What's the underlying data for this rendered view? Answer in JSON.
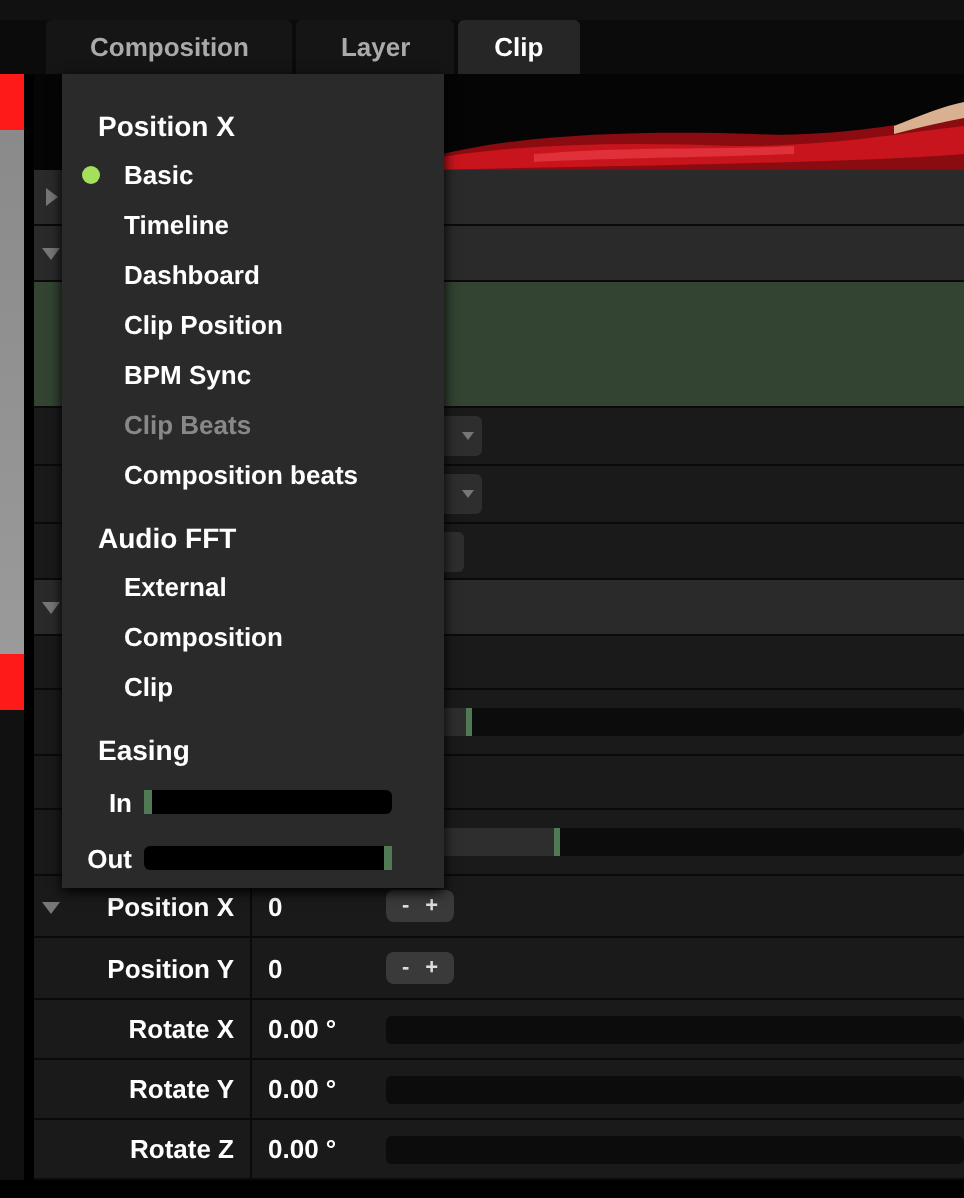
{
  "tabs": [
    {
      "label": "Composition",
      "selected": false
    },
    {
      "label": "Layer",
      "selected": false
    },
    {
      "label": "Clip",
      "selected": true
    }
  ],
  "rows": [
    {
      "kind": "header",
      "expanded": false
    },
    {
      "kind": "header",
      "expanded": true
    },
    {
      "kind": "highlight"
    },
    {
      "kind": "dropdown"
    },
    {
      "kind": "dropdown"
    },
    {
      "kind": "button"
    },
    {
      "kind": "header",
      "expanded": true
    },
    {
      "kind": "blank"
    },
    {
      "kind": "slider",
      "level": 0.14
    },
    {
      "kind": "blank"
    },
    {
      "kind": "slider",
      "level": 0.29
    },
    {
      "kind": "stepper",
      "label": "Position X",
      "value": "0",
      "expanded": true,
      "buttons": [
        "-",
        "+"
      ]
    },
    {
      "kind": "stepper",
      "label": "Position Y",
      "value": "0",
      "buttons": [
        "-",
        "+"
      ]
    },
    {
      "kind": "slider",
      "label": "Rotate X",
      "value": "0.00 °"
    },
    {
      "kind": "slider",
      "label": "Rotate Y",
      "value": "0.00 °"
    },
    {
      "kind": "slider",
      "label": "Rotate Z",
      "value": "0.00 °"
    }
  ],
  "menu": {
    "sections": [
      {
        "kind": "options",
        "title": "Position X",
        "items": [
          {
            "label": "Basic",
            "selected": true,
            "disabled": false
          },
          {
            "label": "Timeline",
            "selected": false,
            "disabled": false
          },
          {
            "label": "Dashboard",
            "selected": false,
            "disabled": false
          },
          {
            "label": "Clip Position",
            "selected": false,
            "disabled": false
          },
          {
            "label": "BPM Sync",
            "selected": false,
            "disabled": false
          },
          {
            "label": "Clip Beats",
            "selected": false,
            "disabled": true
          },
          {
            "label": "Composition beats",
            "selected": false,
            "disabled": false
          }
        ]
      },
      {
        "kind": "options",
        "title": "Audio FFT",
        "items": [
          {
            "label": "External",
            "selected": false,
            "disabled": false
          },
          {
            "label": "Composition",
            "selected": false,
            "disabled": false
          },
          {
            "label": "Clip",
            "selected": false,
            "disabled": false
          }
        ]
      },
      {
        "kind": "sliders",
        "title": "Easing",
        "sliders": [
          {
            "label": "In",
            "level": 0
          },
          {
            "label": "Out",
            "level": 1
          }
        ]
      }
    ]
  }
}
